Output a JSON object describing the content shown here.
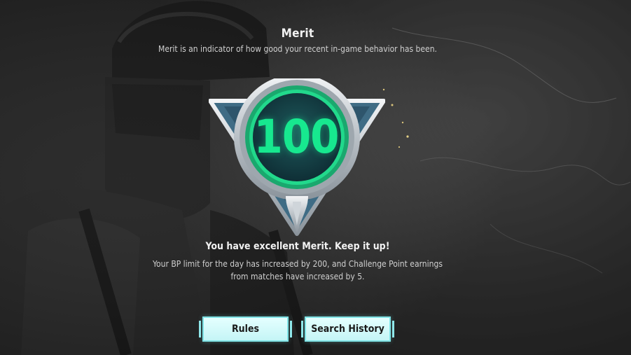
{
  "screen": {
    "title": "Merit",
    "subtitle": "Merit is an indicator of how good your recent in-game behavior has been."
  },
  "badge": {
    "score": "100",
    "accent_color": "#17e88f"
  },
  "message": {
    "headline": "You have excellent Merit. Keep it up!",
    "detail": "Your BP limit for the day has increased by 200, and Challenge Point earnings from matches have increased by 5."
  },
  "buttons": {
    "rules_label": "Rules",
    "history_label": "Search History",
    "color": "#c4f5f6"
  }
}
